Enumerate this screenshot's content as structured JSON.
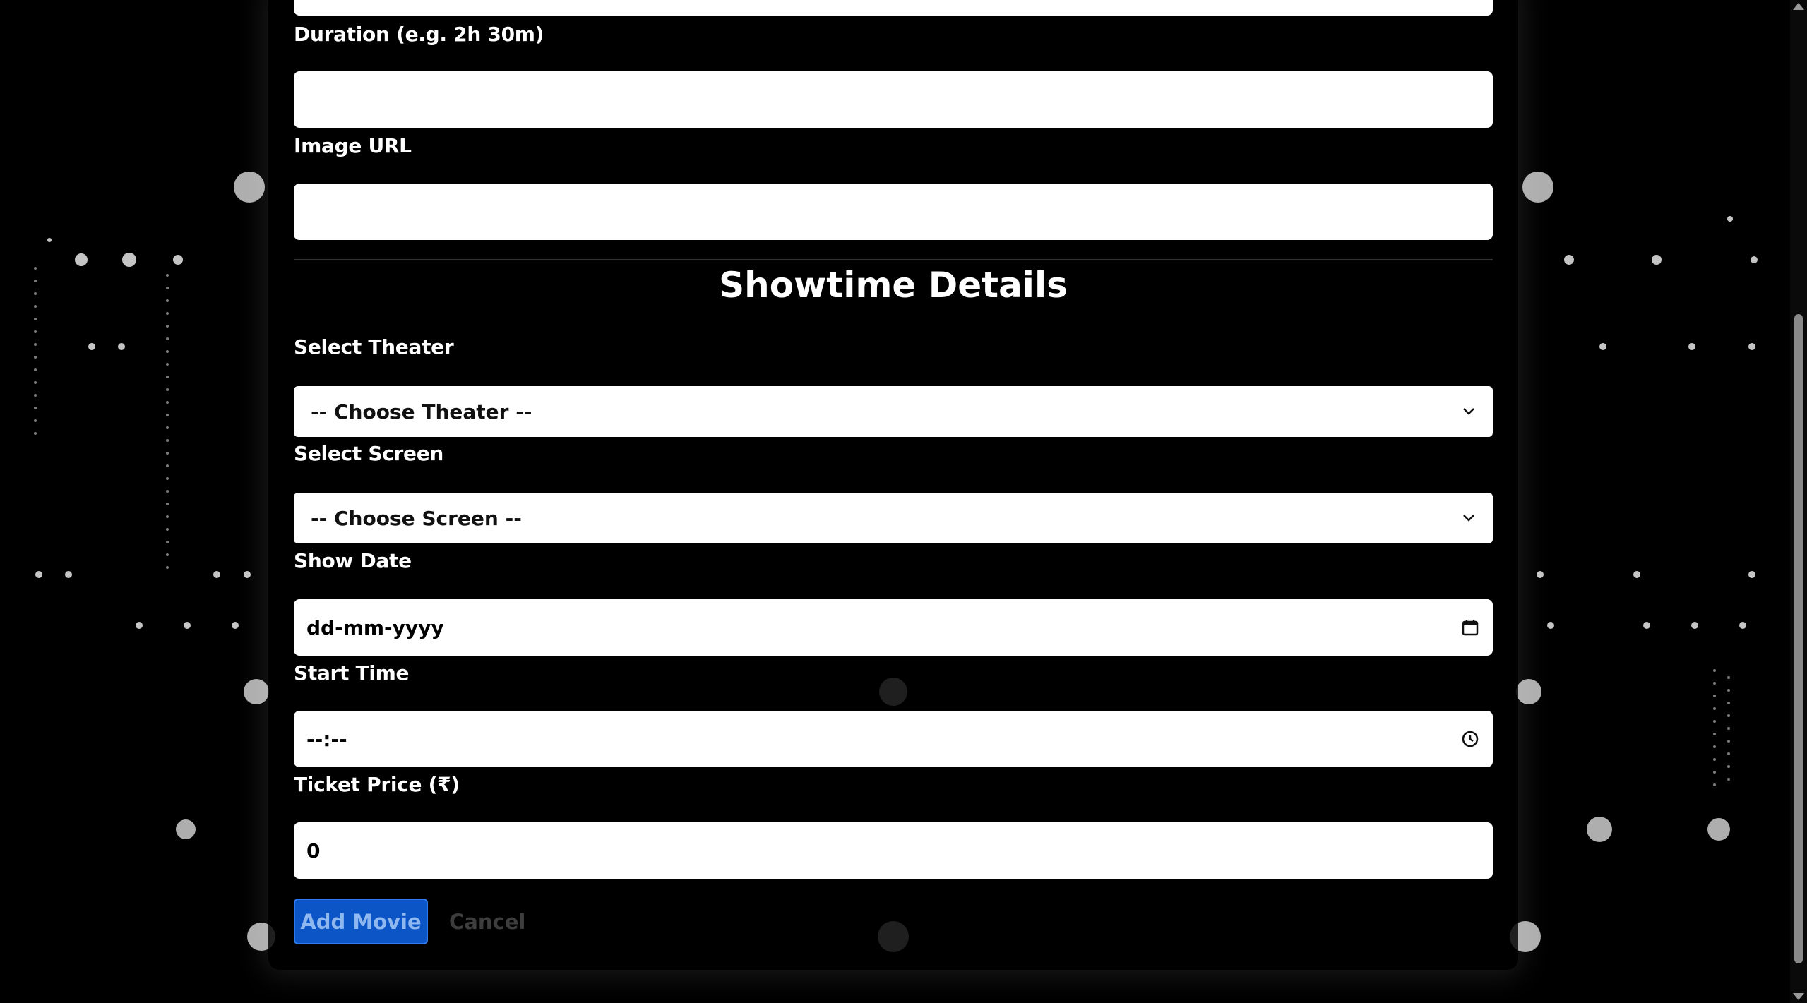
{
  "form": {
    "duration_label": "Duration (e.g. 2h 30m)",
    "duration_value": "",
    "image_url_label": "Image URL",
    "image_url_value": "",
    "showtime_title": "Showtime Details",
    "theater_label": "Select Theater",
    "theater_selected": "-- Choose Theater --",
    "screen_label": "Select Screen",
    "screen_selected": "-- Choose Screen --",
    "show_date_label": "Show Date",
    "show_date_value": "dd-mm-yyyy",
    "start_time_label": "Start Time",
    "start_time_value": "--:--",
    "ticket_price_label": "Ticket Price (₹)",
    "ticket_price_value": "0"
  },
  "actions": {
    "add_label": "Add Movie",
    "cancel_label": "Cancel"
  },
  "icons": {
    "select_arrow": "chevron-down-icon",
    "date_picker": "calendar-icon",
    "time_picker": "clock-icon"
  },
  "colors": {
    "background": "#000000",
    "primary_button": "#0b55c7",
    "input_bg": "#ffffff"
  }
}
